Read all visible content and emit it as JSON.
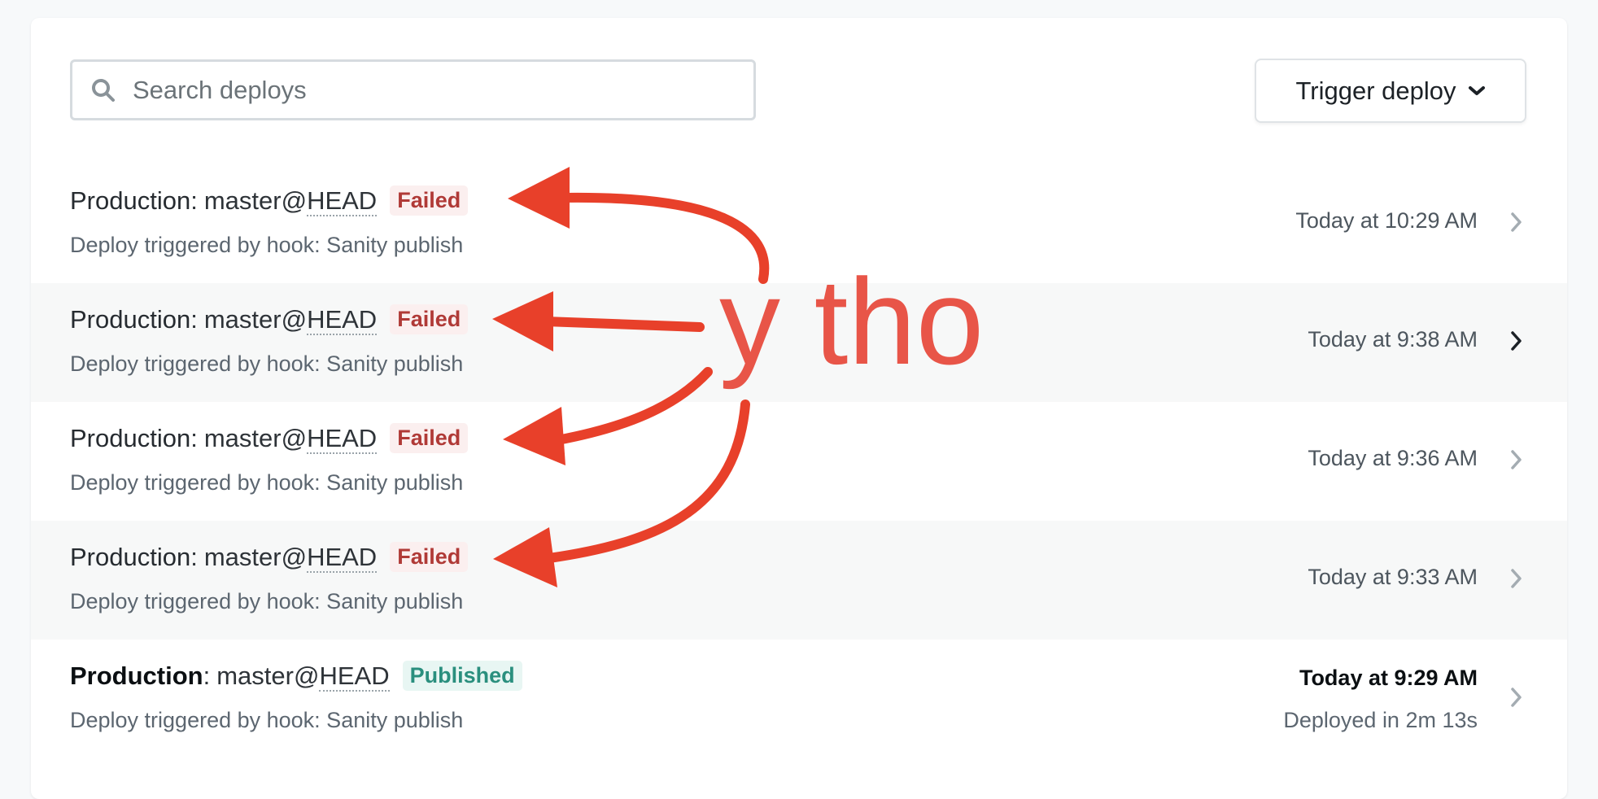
{
  "search": {
    "placeholder": "Search deploys",
    "value": ""
  },
  "trigger_deploy": {
    "label": "Trigger deploy"
  },
  "deploys": [
    {
      "environment": "Production",
      "separator": ":",
      "branch": "master@",
      "ref": "HEAD",
      "status": "Failed",
      "description": "Deploy triggered by hook: Sanity publish",
      "time": "Today at 10:29 AM",
      "duration": ""
    },
    {
      "environment": "Production",
      "separator": ":",
      "branch": "master@",
      "ref": "HEAD",
      "status": "Failed",
      "description": "Deploy triggered by hook: Sanity publish",
      "time": "Today at 9:38 AM",
      "duration": ""
    },
    {
      "environment": "Production",
      "separator": ":",
      "branch": "master@",
      "ref": "HEAD",
      "status": "Failed",
      "description": "Deploy triggered by hook: Sanity publish",
      "time": "Today at 9:36 AM",
      "duration": ""
    },
    {
      "environment": "Production",
      "separator": ":",
      "branch": "master@",
      "ref": "HEAD",
      "status": "Failed",
      "description": "Deploy triggered by hook: Sanity publish",
      "time": "Today at 9:33 AM",
      "duration": ""
    },
    {
      "environment": "Production",
      "separator": ":",
      "branch": "master@",
      "ref": "HEAD",
      "status": "Published",
      "description": "Deploy triggered by hook: Sanity publish",
      "time": "Today at 9:29 AM",
      "duration": "Deployed in 2m 13s"
    }
  ],
  "annotation": {
    "text": "y tho",
    "color": "#e8402a"
  },
  "colors": {
    "failed": "#b03a37",
    "published": "#2a8f7e",
    "annotation": "#e85548"
  },
  "icons": {
    "search": "search-icon",
    "dropdown": "chevron-down-icon",
    "row_arrow": "chevron-right-icon"
  }
}
